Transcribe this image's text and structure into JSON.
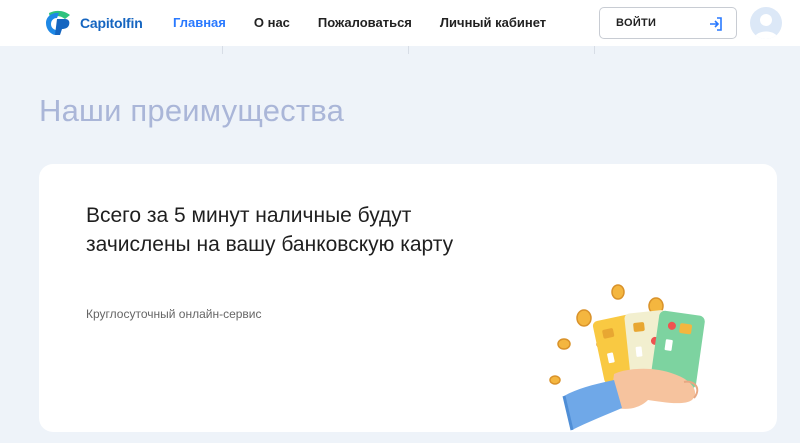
{
  "header": {
    "logo_text": "Capitolfin",
    "nav": [
      "Главная",
      "О нас",
      "Пожаловаться",
      "Личный кабинет"
    ],
    "login_label": "ВОЙТИ"
  },
  "colors": {
    "accent": "#2979ff",
    "title_muted": "#aab6d8",
    "page_bg": "#eef3f9"
  },
  "icons": [
    "logo-icon",
    "login-arrow-icon",
    "user-avatar-icon",
    "hand-cards-coins-illustration"
  ],
  "main": {
    "section_title": "Наши преимущества",
    "card": {
      "title": "Всего за 5 минут наличные будут зачислены на вашу банковскую карту",
      "subtitle": "Круглосуточный онлайн-сервис"
    }
  }
}
